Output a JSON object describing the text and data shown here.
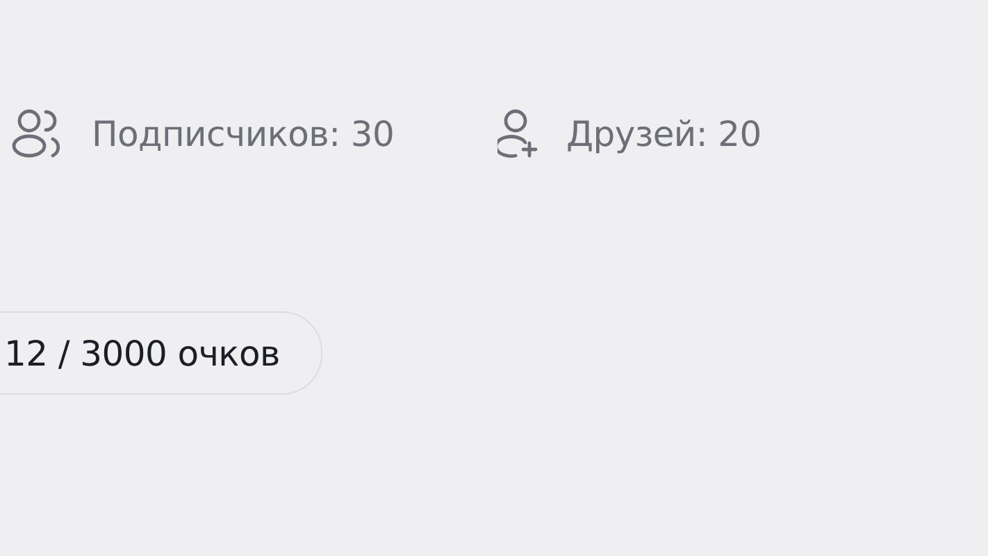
{
  "stats": [
    {
      "kind": "followers",
      "label": "Подписчиков: 30"
    },
    {
      "kind": "friends",
      "label": "Друзей: 20"
    }
  ],
  "points_badge": "12 / 3000 очков"
}
